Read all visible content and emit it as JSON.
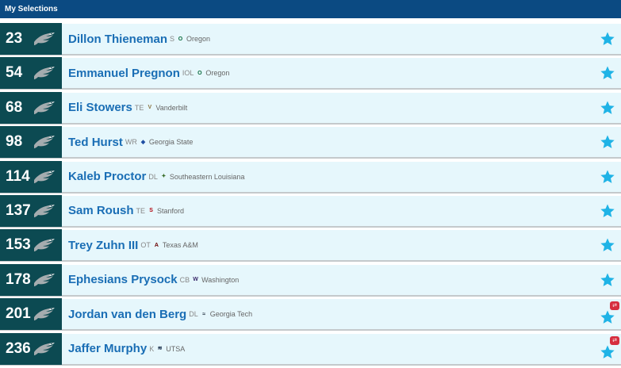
{
  "header": {
    "title": "My Selections"
  },
  "colors": {
    "header_bg": "#0b4a82",
    "pick_bg": "#0c4a52",
    "row_bg": "#e6f7fc",
    "name": "#1a6eb5",
    "star": "#1fb3e6",
    "trade_badge": "#d62e3e"
  },
  "team_icon": "eagle-logo-icon",
  "selections": [
    {
      "pick": "23",
      "name": "Dillon Thieneman",
      "position": "S",
      "school": "Oregon",
      "school_icon": "oregon-logo-icon",
      "traded": false
    },
    {
      "pick": "54",
      "name": "Emmanuel Pregnon",
      "position": "IOL",
      "school": "Oregon",
      "school_icon": "oregon-logo-icon",
      "traded": false
    },
    {
      "pick": "68",
      "name": "Eli Stowers",
      "position": "TE",
      "school": "Vanderbilt",
      "school_icon": "vanderbilt-logo-icon",
      "traded": false
    },
    {
      "pick": "98",
      "name": "Ted Hurst",
      "position": "WR",
      "school": "Georgia State",
      "school_icon": "georgia-state-logo-icon",
      "traded": false
    },
    {
      "pick": "114",
      "name": "Kaleb Proctor",
      "position": "DL",
      "school": "Southeastern Louisiana",
      "school_icon": "southeastern-logo-icon",
      "traded": false
    },
    {
      "pick": "137",
      "name": "Sam Roush",
      "position": "TE",
      "school": "Stanford",
      "school_icon": "stanford-logo-icon",
      "traded": false
    },
    {
      "pick": "153",
      "name": "Trey Zuhn III",
      "position": "OT",
      "school": "Texas A&M",
      "school_icon": "texas-am-logo-icon",
      "traded": false
    },
    {
      "pick": "178",
      "name": "Ephesians Prysock",
      "position": "CB",
      "school": "Washington",
      "school_icon": "washington-logo-icon",
      "traded": false
    },
    {
      "pick": "201",
      "name": "Jordan van den Berg",
      "position": "DL",
      "school": "Georgia Tech",
      "school_icon": "georgia-tech-logo-icon",
      "traded": true
    },
    {
      "pick": "236",
      "name": "Jaffer Murphy",
      "position": "K",
      "school": "UTSA",
      "school_icon": "utsa-logo-icon",
      "traded": true
    }
  ]
}
